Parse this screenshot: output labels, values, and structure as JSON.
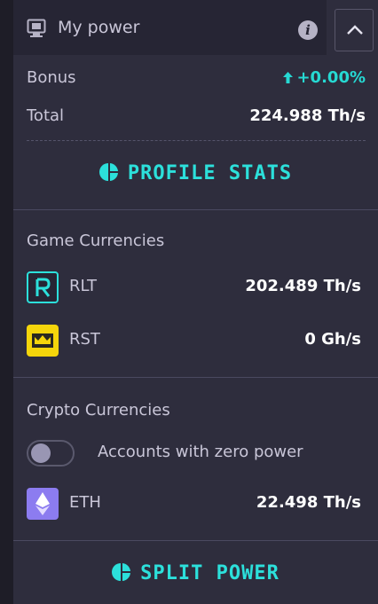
{
  "header": {
    "title": "My power",
    "icon": "monitor-icon",
    "info_icon": "info-icon",
    "collapse_icon": "chevron-up-icon"
  },
  "bonus": {
    "label": "Bonus",
    "value": "+0.00%",
    "arrow_icon": "arrow-up-icon"
  },
  "total": {
    "label": "Total",
    "value": "224.988 Th/s"
  },
  "profile_stats": {
    "label": "PROFILE STATS",
    "icon": "pie-chart-icon"
  },
  "game_currencies": {
    "title": "Game Currencies",
    "items": [
      {
        "name": "RLT",
        "value": "202.489 Th/s",
        "icon": "rlt-icon"
      },
      {
        "name": "RST",
        "value": "0 Gh/s",
        "icon": "crown-icon"
      }
    ]
  },
  "crypto_currencies": {
    "title": "Crypto Currencies",
    "toggle_label": "Accounts with zero power",
    "toggle_state": "off",
    "items": [
      {
        "name": "ETH",
        "value": "22.498 Th/s",
        "icon": "eth-icon"
      }
    ]
  },
  "split_power": {
    "label": "SPLIT POWER",
    "icon": "pie-chart-icon"
  },
  "colors": {
    "accent": "#2ce0db",
    "panel": "#2e2d3d",
    "header": "#262534",
    "eth": "#8c7cf0",
    "rst": "#f5d50b"
  }
}
